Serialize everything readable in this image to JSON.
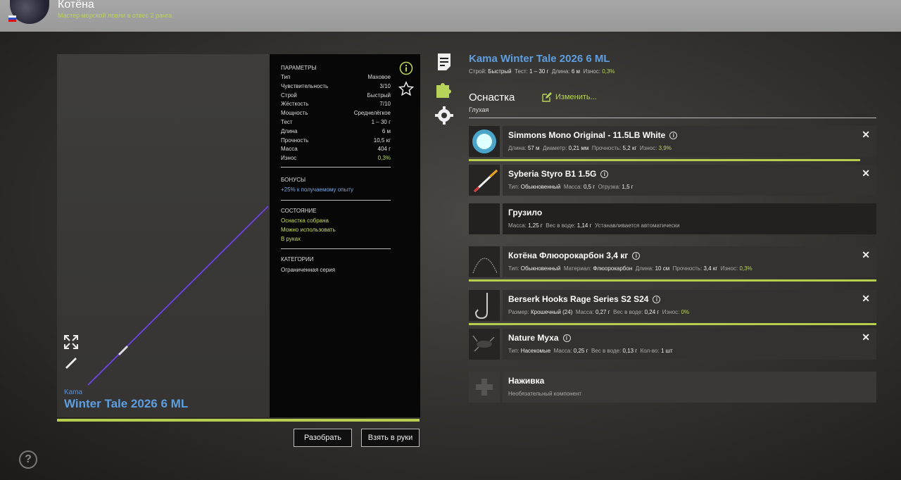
{
  "user": {
    "name": "Котёна",
    "rank": "Мастер морской ловли в отвес 2 ранга"
  },
  "rod": {
    "brand": "Kama",
    "model": "Winter Tale 2026 6 ML"
  },
  "params": {
    "header": "Параметры",
    "rows": [
      {
        "k": "Тип",
        "v": "Маховое"
      },
      {
        "k": "Чувствительность",
        "v": "3/10"
      },
      {
        "k": "Строй",
        "v": "Быстрый"
      },
      {
        "k": "Жёсткость",
        "v": "7/10"
      },
      {
        "k": "Мощность",
        "v": "Среднелёгкое"
      },
      {
        "k": "Тест",
        "v": "1 – 30 г"
      },
      {
        "k": "Длина",
        "v": "6 м"
      },
      {
        "k": "Прочность",
        "v": "10,5 кг"
      },
      {
        "k": "Масса",
        "v": "404 г"
      },
      {
        "k": "Износ",
        "v": "0,3%"
      }
    ],
    "bonuses_header": "Бонусы",
    "bonus": "+25% к получаемому опыту",
    "state_header": "Состояние",
    "state": [
      "Оснастка собрана",
      "Можно использовать",
      "В руках"
    ],
    "categories_header": "Категории",
    "category": "Ограниченная серия"
  },
  "buttons": {
    "disassemble": "Разобрать",
    "take": "Взять в руки"
  },
  "right": {
    "title": "Kama Winter Tale 2026 6 ML",
    "stats": {
      "l1": "Строй:",
      "v1": "Быстрый",
      "l2": "Тест:",
      "v2": "1 – 30 г",
      "l3": "Длина:",
      "v3": "6 м",
      "l4": "Износ:",
      "v4": "0,3%"
    },
    "rig_label": "Оснастка",
    "rig_type": "Глухая",
    "change": "Изменить..."
  },
  "components": [
    {
      "name": "Simmons Mono Original - 11.5LB White",
      "det": [
        [
          "Длина:",
          "57 м"
        ],
        [
          "Диаметр:",
          "0,21 мм"
        ],
        [
          "Прочность:",
          "5,2 кг"
        ],
        [
          "Износ:",
          "3,9%"
        ]
      ],
      "wear": 0.96
    },
    {
      "name": "Syberia Styro B1 1.5G",
      "det": [
        [
          "Тип:",
          "Обыкновенный"
        ],
        [
          "Масса:",
          "0,5 г"
        ],
        [
          "Огрузка:",
          "1,5 г"
        ]
      ]
    },
    {
      "name": "Грузило",
      "det": [
        [
          "Масса:",
          "1,25 г"
        ],
        [
          "Вес в воде:",
          "1,14 г"
        ],
        [
          "Устанавливается автоматически",
          ""
        ]
      ]
    },
    {
      "name": "Котёна Флюорокарбон 3,4 кг",
      "det": [
        [
          "Тип:",
          "Обыкновенный"
        ],
        [
          "Материал:",
          "Флюорокарбон"
        ],
        [
          "Длина:",
          "10 см"
        ],
        [
          "Прочность:",
          "3,4 кг"
        ],
        [
          "Износ:",
          "0,3%"
        ]
      ],
      "wear": 1.0
    },
    {
      "name": "Berserk Hooks Rage Series S2 S24",
      "det": [
        [
          "Размер:",
          "Крошечный (24)"
        ],
        [
          "Масса:",
          "0,27 г"
        ],
        [
          "Вес в воде:",
          "0,24 г"
        ],
        [
          "Износ:",
          "0%"
        ]
      ],
      "wear": 1.0
    },
    {
      "name": "Nature Муха",
      "det": [
        [
          "Тип:",
          "Насекомые"
        ],
        [
          "Масса:",
          "0,25 г"
        ],
        [
          "Вес в воде:",
          "0,13 г"
        ],
        [
          "Кол-во:",
          "1 шт"
        ]
      ]
    },
    {
      "name": "Наживка",
      "det": [
        [
          "Необязательный компонент",
          ""
        ]
      ]
    }
  ]
}
